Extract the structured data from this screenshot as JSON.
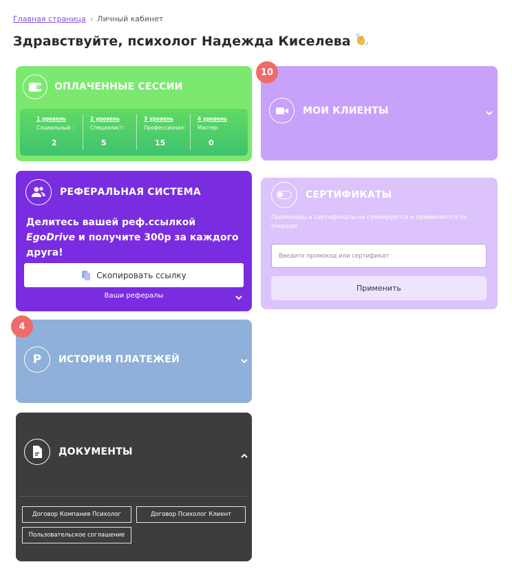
{
  "breadcrumb": {
    "home": "Главная страница",
    "separator": "›",
    "current": "Личный кабинет"
  },
  "page_title": "Здравствуйте, психолог Надежда Киселева",
  "paid_sessions": {
    "title": "ОПЛАЧЕННЫЕ СЕССИИ",
    "levels": [
      {
        "level": "1 уровень",
        "name": "Социальный :",
        "value": "2"
      },
      {
        "level": "2 уровень",
        "name": "Специалист:",
        "value": "5"
      },
      {
        "level": "3 уровень",
        "name": "Профессионал:",
        "value": "15"
      },
      {
        "level": "4 уровень",
        "name": "Мастер:",
        "value": "0"
      }
    ]
  },
  "my_clients": {
    "title": "МОИ КЛИЕНТЫ",
    "badge": "10"
  },
  "referral": {
    "title": "РЕФЕРАЛЬНАЯ СИСТЕМА",
    "text_before": "Делитесь вашей реф.ссылкой ",
    "brand": "EgoDrive",
    "text_after": " и получите 300р за каждого друга!",
    "copy_button": "Скопировать ссылку",
    "referrals_link": "Ваши рефералы"
  },
  "certificates": {
    "title": "СЕРТИФИКАТЫ",
    "note": "Промокоды и сертификаты не суммируются и применяются по очереди.",
    "input_placeholder": "Введите промокод или сертификат",
    "apply_button": "Применить"
  },
  "payments_history": {
    "title": "ИСТОРИЯ ПЛАТЕЖЕЙ",
    "badge": "4",
    "icon_letter": "P"
  },
  "documents": {
    "title": "ДОКУМЕНТЫ",
    "items": [
      "Договор Компания Психолог",
      "Договор Психолог Клиент",
      "Пользовательское соглашение"
    ]
  },
  "colors": {
    "paid": "#7be86f",
    "clients": "#c8a1fb",
    "referral": "#7a2de0",
    "certificates": "#dcc3fc",
    "history": "#8fb0d8",
    "documents": "#3d3d3d",
    "badge": "#f06a6a"
  }
}
